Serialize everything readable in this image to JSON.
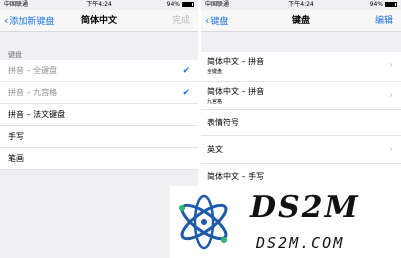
{
  "left_screen": {
    "status": {
      "carrier": "中国联通",
      "time": "下午4:24",
      "battery": "94%"
    },
    "nav": {
      "back_label": "添加新键盘",
      "title": "简体中文",
      "action_label": "完成"
    },
    "section_label": "键盘",
    "rows": [
      {
        "label": "拼音 – 全键盘",
        "checked": true
      },
      {
        "label": "拼音 – 九宫格",
        "checked": true
      },
      {
        "label": "拼音 – 法文键盘",
        "checked": false
      },
      {
        "label": "手写",
        "checked": false
      },
      {
        "label": "笔画",
        "checked": false
      }
    ]
  },
  "right_screen": {
    "status": {
      "carrier": "中国联通",
      "time": "下午4:24",
      "battery": "94%"
    },
    "nav": {
      "back_label": "键盘",
      "title": "键盘",
      "action_label": "编辑"
    },
    "rows": [
      {
        "label": "简体中文 – 拼音",
        "sub": "全键盘"
      },
      {
        "label": "简体中文 – 拼音",
        "sub": "九宫格"
      },
      {
        "label": "表情符号"
      },
      {
        "label": "英文"
      },
      {
        "label": "简体中文 – 手写"
      }
    ]
  },
  "watermark": {
    "big": "DS2M",
    "small": "DS2M.COM"
  },
  "colors": {
    "accent": "#1a73e8",
    "logo_blue": "#1e5aa8",
    "logo_green": "#2bb673"
  }
}
